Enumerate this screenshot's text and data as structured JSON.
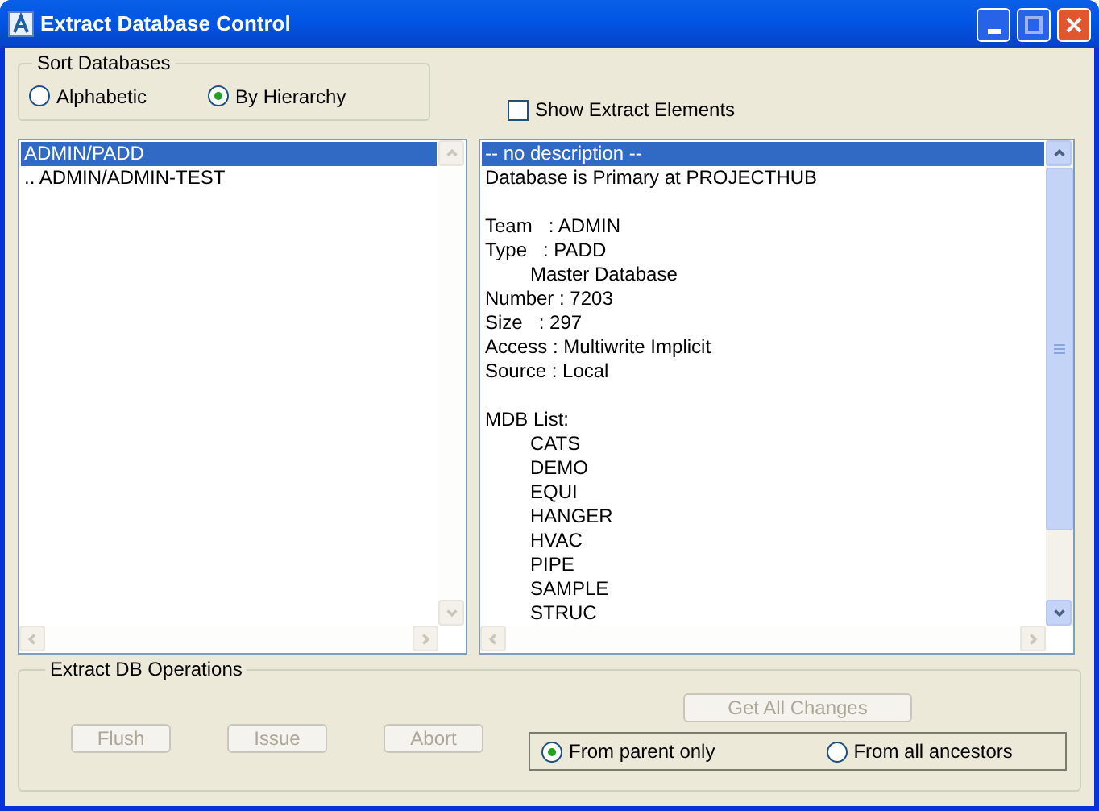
{
  "window": {
    "title": "Extract Database Control"
  },
  "sort_databases": {
    "title": "Sort Databases",
    "options": [
      {
        "label": "Alphabetic",
        "selected": false
      },
      {
        "label": "By Hierarchy",
        "selected": true
      }
    ]
  },
  "show_extract_elements": {
    "label": "Show Extract Elements",
    "checked": false
  },
  "database_list": {
    "items": [
      {
        "text": "ADMIN/PADD",
        "selected": true
      },
      {
        "text": ".. ADMIN/ADMIN-TEST",
        "selected": false
      }
    ]
  },
  "description": {
    "lines": [
      {
        "kind": "plain",
        "text": "-- no description --",
        "selected": true
      },
      {
        "kind": "plain",
        "text": "Database is Primary at PROJECTHUB",
        "selected": false
      },
      {
        "kind": "blank"
      },
      {
        "kind": "plain",
        "text": "Team   : ADMIN",
        "selected": false
      },
      {
        "kind": "plain",
        "text": "Type   : PADD",
        "selected": false
      },
      {
        "kind": "indented",
        "text": "Master Database",
        "selected": false
      },
      {
        "kind": "plain",
        "text": "Number : 7203",
        "selected": false
      },
      {
        "kind": "plain",
        "text": "Size   : 297",
        "selected": false
      },
      {
        "kind": "plain",
        "text": "Access : Multiwrite Implicit",
        "selected": false
      },
      {
        "kind": "plain",
        "text": "Source : Local",
        "selected": false
      },
      {
        "kind": "blank"
      },
      {
        "kind": "plain",
        "text": "MDB List:",
        "selected": false
      },
      {
        "kind": "indented",
        "text": "CATS",
        "selected": false
      },
      {
        "kind": "indented",
        "text": "DEMO",
        "selected": false
      },
      {
        "kind": "indented",
        "text": "EQUI",
        "selected": false
      },
      {
        "kind": "indented",
        "text": "HANGER",
        "selected": false
      },
      {
        "kind": "indented",
        "text": "HVAC",
        "selected": false
      },
      {
        "kind": "indented",
        "text": "PIPE",
        "selected": false
      },
      {
        "kind": "indented",
        "text": "SAMPLE",
        "selected": false
      },
      {
        "kind": "indented",
        "text": "STRUC",
        "selected": false
      }
    ]
  },
  "extract_operations": {
    "title": "Extract DB Operations",
    "buttons": [
      {
        "label": "Flush",
        "disabled": true
      },
      {
        "label": "Issue",
        "disabled": true
      },
      {
        "label": "Abort",
        "disabled": true
      }
    ],
    "get_all_changes": {
      "label": "Get All Changes",
      "disabled": true
    },
    "scope_options": [
      {
        "label": "From parent only",
        "selected": true
      },
      {
        "label": "From all ancestors",
        "selected": false
      }
    ]
  }
}
